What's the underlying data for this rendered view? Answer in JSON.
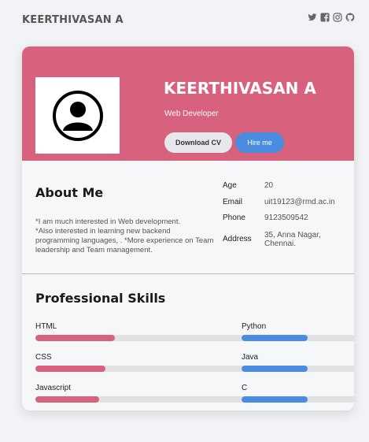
{
  "brand": "KEERTHIVASAN A",
  "social": [
    "twitter-icon",
    "facebook-icon",
    "instagram-icon",
    "github-icon"
  ],
  "colors": {
    "accent_pink": "#d8627e",
    "accent_blue": "#4a8de0",
    "card_bg": "#f6f7f9"
  },
  "hero": {
    "name": "KEERTHIVASAN A",
    "role": "Web Developer",
    "download_label": "Download CV",
    "hire_label": "Hire me"
  },
  "about": {
    "title": "About Me",
    "text": "*I am much interested in Web development.\n*Also interested in learning new backend programming languages, . *More experience on Team leadership and Team management.",
    "info": [
      {
        "label": "Age",
        "value": "20"
      },
      {
        "label": "Email",
        "value": "uit19123@rmd.ac.in"
      },
      {
        "label": "Phone",
        "value": "9123509542"
      },
      {
        "label": "Address",
        "value": "35, Anna Nagar,\nChennai."
      }
    ]
  },
  "skills": {
    "title": "Professional Skills",
    "left": [
      {
        "name": "HTML",
        "level": 0.25
      },
      {
        "name": "CSS",
        "level": 0.22
      },
      {
        "name": "Javascript",
        "level": 0.2
      }
    ],
    "right": [
      {
        "name": "Python",
        "level": 0.52
      },
      {
        "name": "Java",
        "level": 0.52
      },
      {
        "name": "C",
        "level": 0.52
      }
    ]
  }
}
